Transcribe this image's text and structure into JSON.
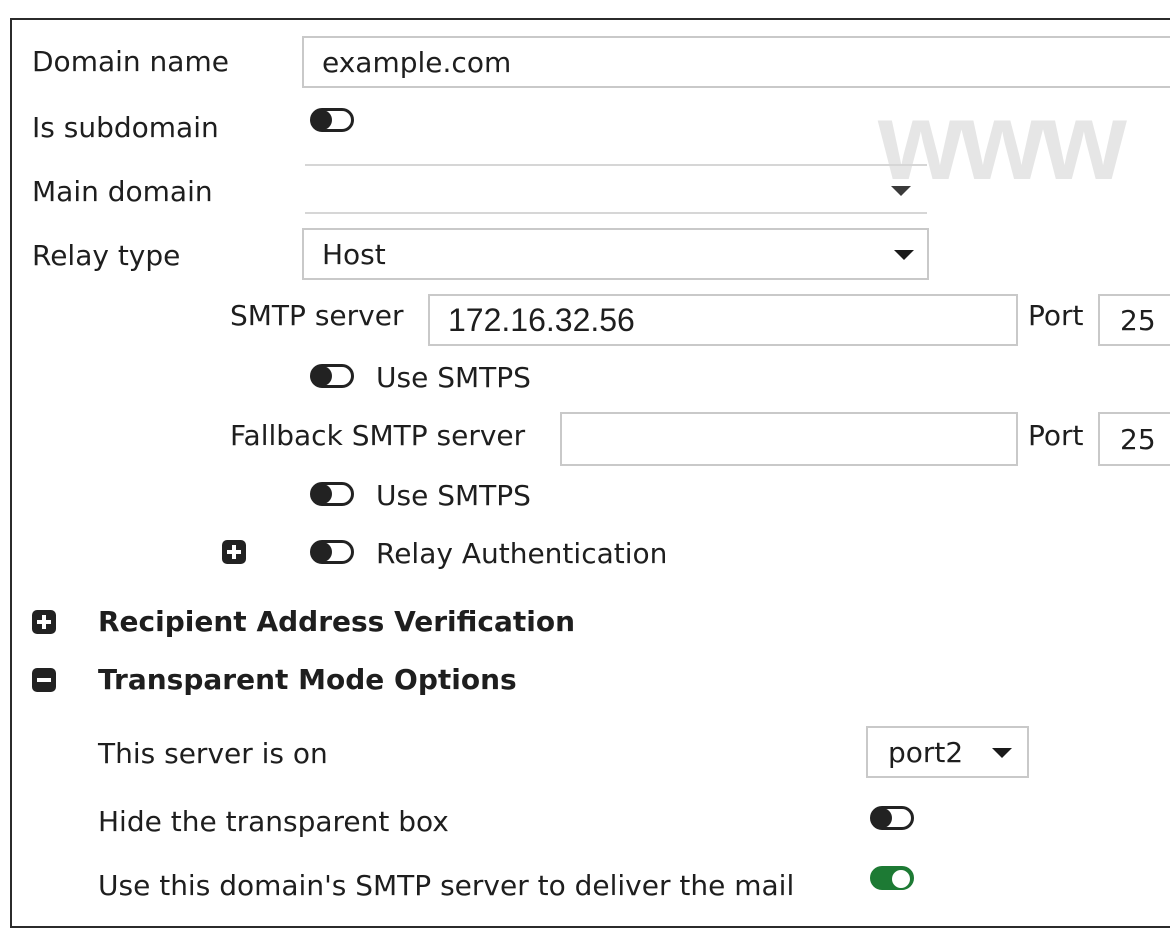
{
  "domain_name": {
    "label": "Domain name",
    "value": "example.com"
  },
  "is_subdomain": {
    "label": "Is subdomain",
    "state": "off"
  },
  "main_domain": {
    "label": "Main domain",
    "value": ""
  },
  "relay_type": {
    "label": "Relay type",
    "value": "Host"
  },
  "smtp_server": {
    "label": "SMTP server",
    "value": "172.16.32.56",
    "port_label": "Port",
    "port": "25",
    "smtps_label": "Use SMTPS",
    "smtps_state": "off"
  },
  "fallback": {
    "label": "Fallback SMTP server",
    "value": "",
    "port_label": "Port",
    "port": "25",
    "smtps_label": "Use SMTPS",
    "smtps_state": "off"
  },
  "relay_auth": {
    "label": "Relay Authentication",
    "state": "off"
  },
  "sections": {
    "recipient": "Recipient Address Verification",
    "transparent": "Transparent Mode Options"
  },
  "transparent": {
    "server_on_label": "This server is on",
    "server_on_value": "port2",
    "hide_label": "Hide the transparent box",
    "hide_state": "off",
    "use_smtp_label": "Use this domain's SMTP server to deliver the mail",
    "use_smtp_state": "on"
  },
  "watermark": "www",
  "colors": {
    "toggle_on": "#1d7a34",
    "border": "#c9c9c9"
  }
}
